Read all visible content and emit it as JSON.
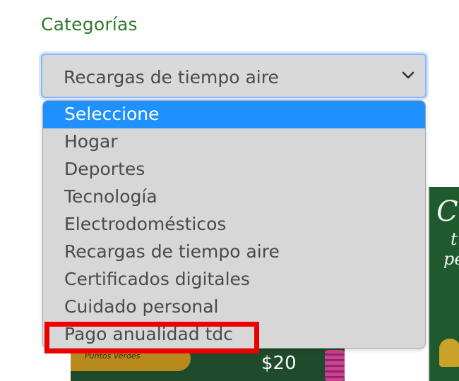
{
  "field": {
    "label": "Categorías",
    "selected_value": "Recargas de tiempo aire"
  },
  "dropdown": {
    "options": [
      "Seleccione",
      "Hogar",
      "Deportes",
      "Tecnología",
      "Electrodomésticos",
      "Recargas de tiempo aire",
      "Certificados digitales",
      "Cuidado personal",
      "Pago anualidad tdc"
    ],
    "highlighted_option": "Seleccione",
    "annotated_option": "Pago anualidad tdc"
  },
  "background_cards": {
    "left_card": {
      "ribbon_text": "Puntos Verdes",
      "price": "$20"
    },
    "right_card": {
      "script_lines": [
        "Ca",
        "t",
        "pe"
      ]
    }
  },
  "colors": {
    "label_green": "#2f7a2a",
    "select_bg": "#d9d9d9",
    "focus_border": "#86b7fe",
    "option_highlight": "#1e90ff",
    "annotation_red": "#ee0000"
  },
  "icons": {
    "select_arrow": "chevron-down-icon"
  }
}
